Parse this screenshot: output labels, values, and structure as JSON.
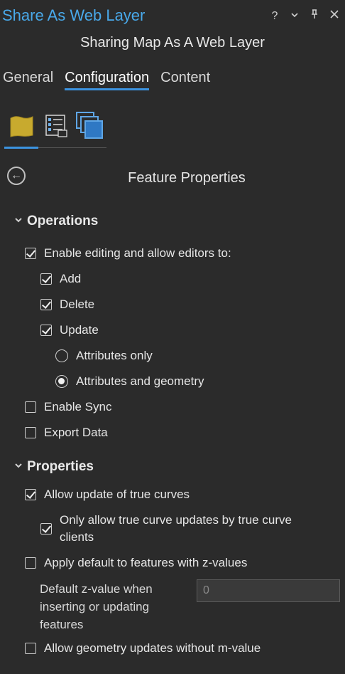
{
  "pane": {
    "title": "Share As Web Layer",
    "help_glyph": "?",
    "menu_glyph": "⌄",
    "pin_glyph": "⊥",
    "close_glyph": "✕"
  },
  "subtitle": "Sharing Map As A Web Layer",
  "tabs": [
    {
      "label": "General",
      "active": false
    },
    {
      "label": "Configuration",
      "active": true
    },
    {
      "label": "Content",
      "active": false
    }
  ],
  "config_icons": [
    "layer-feature-icon",
    "properties-list-icon",
    "stacked-pages-icon"
  ],
  "panel": {
    "back_glyph": "←",
    "heading": "Feature Properties"
  },
  "operations": {
    "label": "Operations",
    "enable_editing": {
      "label": "Enable editing and allow editors to:",
      "checked": true
    },
    "add": {
      "label": "Add",
      "checked": true
    },
    "delete": {
      "label": "Delete",
      "checked": true
    },
    "update": {
      "label": "Update",
      "checked": true
    },
    "attributes_only": {
      "label": "Attributes only",
      "selected": false
    },
    "attributes_geometry": {
      "label": "Attributes and geometry",
      "selected": true
    },
    "enable_sync": {
      "label": "Enable Sync",
      "checked": false
    },
    "export_data": {
      "label": "Export Data",
      "checked": false
    }
  },
  "properties": {
    "label": "Properties",
    "allow_true_curves": {
      "label": "Allow update of true curves",
      "checked": true
    },
    "only_true_curve_clients": {
      "label": "Only allow true curve updates by true curve clients",
      "checked": true
    },
    "apply_default_z": {
      "label": "Apply default to features with z-values",
      "checked": false
    },
    "default_z_label": "Default z-value when inserting or updating features",
    "default_z_value": "0",
    "allow_geom_without_m": {
      "label": "Allow geometry updates without m-value",
      "checked": false
    }
  },
  "colors": {
    "background": "#2b2b2b",
    "accent": "#3c93e0",
    "title_blue": "#49a9ea"
  }
}
